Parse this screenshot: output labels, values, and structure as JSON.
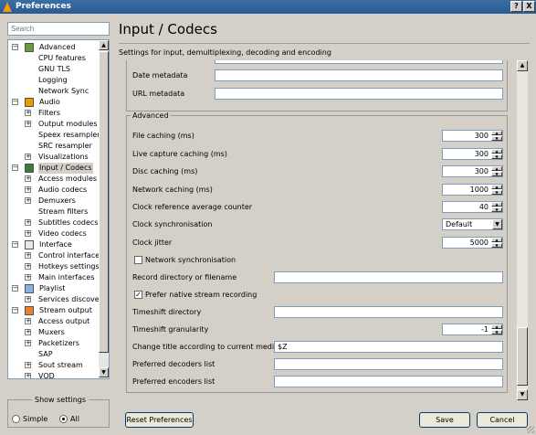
{
  "window": {
    "title": "Preferences",
    "help_btn": "?",
    "close_btn": "X"
  },
  "search": {
    "placeholder": "Search"
  },
  "tree": {
    "nodes": [
      {
        "label": "Advanced",
        "kind": "cat",
        "icon": "advanced",
        "expanded": true
      },
      {
        "label": "CPU features",
        "kind": "leaf"
      },
      {
        "label": "GNU TLS",
        "kind": "leaf"
      },
      {
        "label": "Logging",
        "kind": "leaf"
      },
      {
        "label": "Network Sync",
        "kind": "leaf"
      },
      {
        "label": "Audio",
        "kind": "cat",
        "icon": "audio",
        "expanded": true
      },
      {
        "label": "Filters",
        "kind": "sub",
        "expandable": true
      },
      {
        "label": "Output modules",
        "kind": "sub",
        "expandable": true
      },
      {
        "label": "Speex resampler",
        "kind": "leaf"
      },
      {
        "label": "SRC resampler",
        "kind": "leaf"
      },
      {
        "label": "Visualizations",
        "kind": "sub",
        "expandable": true
      },
      {
        "label": "Input / Codecs",
        "kind": "cat",
        "icon": "input",
        "expanded": true,
        "selected": true
      },
      {
        "label": "Access modules",
        "kind": "sub",
        "expandable": true
      },
      {
        "label": "Audio codecs",
        "kind": "sub",
        "expandable": true
      },
      {
        "label": "Demuxers",
        "kind": "sub",
        "expandable": true
      },
      {
        "label": "Stream filters",
        "kind": "leaf"
      },
      {
        "label": "Subtitles codecs",
        "kind": "sub",
        "expandable": true
      },
      {
        "label": "Video codecs",
        "kind": "sub",
        "expandable": true
      },
      {
        "label": "Interface",
        "kind": "cat",
        "icon": "interface",
        "expanded": true
      },
      {
        "label": "Control interfaces",
        "kind": "sub",
        "expandable": true
      },
      {
        "label": "Hotkeys settings",
        "kind": "sub",
        "expandable": true
      },
      {
        "label": "Main interfaces",
        "kind": "sub",
        "expandable": true
      },
      {
        "label": "Playlist",
        "kind": "cat",
        "icon": "playlist",
        "expanded": true
      },
      {
        "label": "Services discovery",
        "kind": "sub",
        "expandable": true
      },
      {
        "label": "Stream output",
        "kind": "cat",
        "icon": "stream",
        "expanded": true
      },
      {
        "label": "Access output",
        "kind": "sub",
        "expandable": true
      },
      {
        "label": "Muxers",
        "kind": "sub",
        "expandable": true
      },
      {
        "label": "Packetizers",
        "kind": "sub",
        "expandable": true
      },
      {
        "label": "SAP",
        "kind": "leaf"
      },
      {
        "label": "Sout stream",
        "kind": "sub",
        "expandable": true
      },
      {
        "label": "VOD",
        "kind": "sub",
        "expandable": true
      }
    ]
  },
  "settings": {
    "legend": "Show settings",
    "simple": "Simple",
    "all": "All",
    "selected": "All"
  },
  "page": {
    "title": "Input / Codecs",
    "description": "Settings for input, demultiplexing, decoding and encoding"
  },
  "meta": {
    "date_label": "Date metadata",
    "date_value": "",
    "url_label": "URL metadata",
    "url_value": ""
  },
  "advanced": {
    "legend": "Advanced",
    "file_caching": {
      "label": "File caching (ms)",
      "value": "300"
    },
    "live_caching": {
      "label": "Live capture caching (ms)",
      "value": "300"
    },
    "disc_caching": {
      "label": "Disc caching (ms)",
      "value": "300"
    },
    "net_caching": {
      "label": "Network caching (ms)",
      "value": "1000"
    },
    "clock_ref": {
      "label": "Clock reference average counter",
      "value": "40"
    },
    "clock_sync": {
      "label": "Clock synchronisation",
      "value": "Default"
    },
    "clock_jitter": {
      "label": "Clock jitter",
      "value": "5000"
    },
    "net_sync": {
      "label": "Network synchronisation",
      "checked": false
    },
    "record_dir": {
      "label": "Record directory or filename",
      "value": ""
    },
    "native_rec": {
      "label": "Prefer native stream recording",
      "checked": true
    },
    "timeshift_dir": {
      "label": "Timeshift directory",
      "value": ""
    },
    "timeshift_gran": {
      "label": "Timeshift granularity",
      "value": "-1"
    },
    "change_title": {
      "label": "Change title according to current media",
      "value": "$Z"
    },
    "pref_dec": {
      "label": "Preferred decoders list",
      "value": ""
    },
    "pref_enc": {
      "label": "Preferred encoders list",
      "value": ""
    }
  },
  "buttons": {
    "reset": "Reset Preferences",
    "save": "Save",
    "cancel": "Cancel"
  },
  "colors": {
    "titlebar": "#2a5a94",
    "window_bg": "#d4d0c8",
    "field_border": "#7f9db9"
  }
}
